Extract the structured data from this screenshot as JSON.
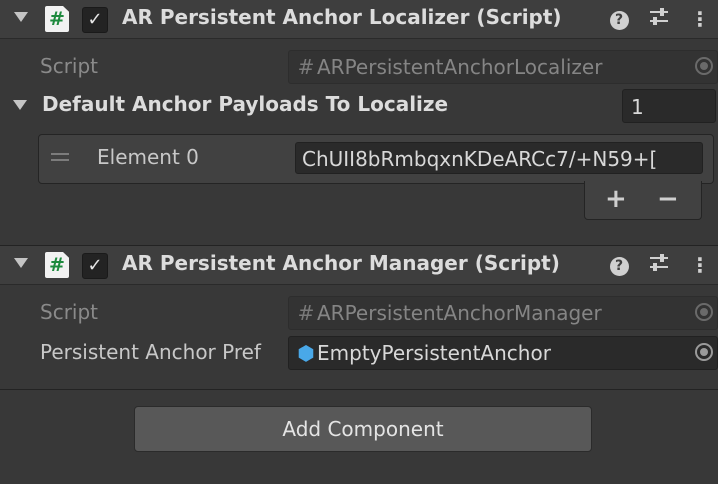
{
  "components": [
    {
      "title": "AR Persistent Anchor Localizer (Script)",
      "enabled": true,
      "script_label": "Script",
      "script_value": "ARPersistentAnchorLocalizer",
      "array": {
        "label": "Default Anchor Payloads To Localize",
        "size": "1",
        "element_label": "Element 0",
        "element_value": "ChUII8bRmbqxnKDeARCc7/+N59+[",
        "add_label": "+",
        "remove_label": "−"
      }
    },
    {
      "title": "AR Persistent Anchor Manager (Script)",
      "enabled": true,
      "script_label": "Script",
      "script_value": "ARPersistentAnchorManager",
      "prefab_label": "Persistent Anchor Pref",
      "prefab_value": "EmptyPersistentAnchor"
    }
  ],
  "icons": {
    "script": "#",
    "check": "✓",
    "help": "?",
    "presets": "⫶",
    "kebab": "⋮",
    "cube": "⬢"
  },
  "add_component_label": "Add Component",
  "colors": {
    "background": "#383838",
    "header": "#3e3e3e",
    "field": "#2a2a2a",
    "script_icon_green": "#1e8a3e",
    "prefab_icon_blue": "#49a8e8"
  }
}
